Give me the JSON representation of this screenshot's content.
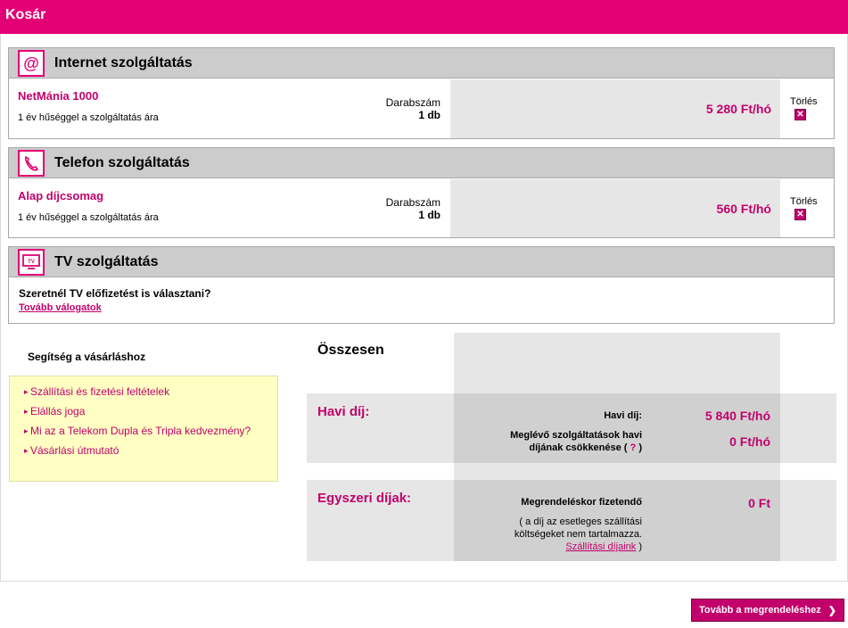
{
  "header": {
    "title": "Kosár"
  },
  "sections": {
    "internet": {
      "title": "Internet szolgáltatás",
      "icon": "at-sign-icon",
      "product_name": "NetMánia 1000",
      "product_desc": "1 év hűséggel a szolgáltatás ára",
      "qty_label": "Darabszám",
      "qty_value": "1 db",
      "price": "5 280 Ft/hó",
      "delete_label": "Törlés"
    },
    "phone": {
      "title": "Telefon szolgáltatás",
      "icon": "phone-handset-icon",
      "product_name": "Alap díjcsomag",
      "product_desc": "1 év hűséggel a szolgáltatás ára",
      "qty_label": "Darabszám",
      "qty_value": "1 db",
      "price": "560 Ft/hó",
      "delete_label": "Törlés"
    },
    "tv": {
      "title": "TV szolgáltatás",
      "icon": "tv-icon",
      "question": "Szeretnél TV előfizetést is választani?",
      "link": "Tovább válogatok"
    }
  },
  "help": {
    "title": "Segítség a vásárláshoz",
    "items": [
      "Szállítási és fizetési feltételek",
      "Elállás joga",
      "Mi az a Telekom Dupla és Tripla kedvezmény?",
      "Vásárlási útmutató"
    ]
  },
  "summary": {
    "title": "Összesen",
    "monthly": {
      "heading": "Havi díj:",
      "fee_label": "Havi díj:",
      "fee_value": "5 840 Ft/hó",
      "reduction_label_1": "Meglévő szolgáltatások havi",
      "reduction_label_2": "díjának csökkenése",
      "help_mark": "?",
      "reduction_value": "0 Ft/hó"
    },
    "one_time": {
      "heading": "Egyszeri díjak:",
      "due_label": "Megrendeléskor fizetendő",
      "due_value": "0 Ft",
      "note_1": "( a díj az esetleges szállítási",
      "note_2": "költségeket nem tartalmazza.",
      "shipping_link": "Szállítási díjaink",
      "note_close": ")"
    }
  },
  "footer": {
    "next_button": "Tovább a megrendeléshez",
    "next_icon": "chevron-right-icon"
  },
  "colors": {
    "brand": "#e20074",
    "accent_text": "#c2006b",
    "help_bg": "#ffffc4"
  }
}
